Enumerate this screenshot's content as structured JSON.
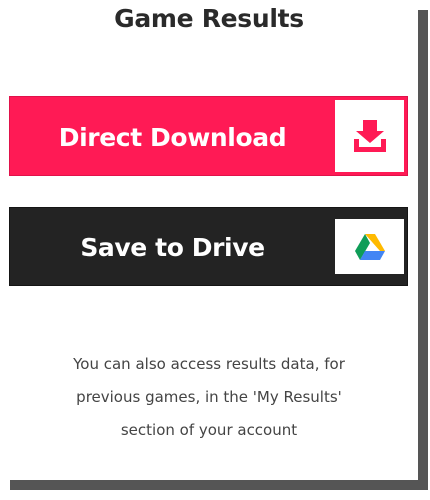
{
  "panel": {
    "title": "Game Results"
  },
  "buttons": {
    "direct_download": {
      "label": "Direct Download",
      "icon": "download-icon",
      "color": "#ff1a55"
    },
    "save_to_drive": {
      "label": "Save to Drive",
      "icon": "google-drive-icon",
      "color": "#232323"
    }
  },
  "note": {
    "line1": "You can also access results data, for",
    "line2": "previous games, in the 'My Results'",
    "line3": "section of your account"
  }
}
